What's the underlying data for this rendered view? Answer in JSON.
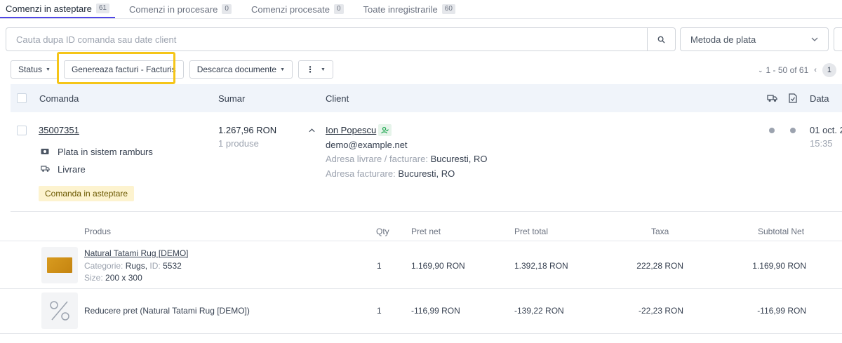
{
  "tabs": [
    {
      "label": "Comenzi in asteptare",
      "count": "61"
    },
    {
      "label": "Comenzi in procesare",
      "count": "0"
    },
    {
      "label": "Comenzi procesate",
      "count": "0"
    },
    {
      "label": "Toate inregistrarile",
      "count": "60"
    }
  ],
  "search": {
    "placeholder": "Cauta dupa ID comanda sau date client"
  },
  "filters": {
    "payment_method_placeholder": "Metoda de plata"
  },
  "toolbar": {
    "status_label": "Status",
    "generate_invoices_label": "Genereaza facturi - Facturis",
    "download_docs_label": "Descarca documente",
    "more_label": "⋮"
  },
  "pagination": {
    "range": "1 - 50 of 61",
    "page": "1"
  },
  "table_headers": {
    "order": "Comanda",
    "summary": "Sumar",
    "client": "Client",
    "date": "Data"
  },
  "order": {
    "id": "35007351",
    "payment": "Plata in sistem ramburs",
    "delivery": "Livrare",
    "status": "Comanda in asteptare",
    "total": "1.267,96 RON",
    "products_count": "1 produse",
    "client_name": "Ion Popescu",
    "client_email": "demo@example.net",
    "shipping_label": "Adresa livrare / facturare:",
    "shipping_value": "Bucuresti, RO",
    "billing_label": "Adresa facturare:",
    "billing_value": "Bucuresti, RO",
    "date": "01 oct. 2",
    "time": "15:35"
  },
  "products_headers": {
    "product": "Produs",
    "qty": "Qty",
    "net_price": "Pret net",
    "total_price": "Pret total",
    "tax": "Taxa",
    "subtotal": "Subtotal Net"
  },
  "products": [
    {
      "name": "Natural Tatami Rug [DEMO]",
      "category_label": "Categorie:",
      "category": "Rugs",
      "id_label": "ID:",
      "id": "5532",
      "size_label": "Size:",
      "size": "200 x 300",
      "qty": "1",
      "net_price": "1.169,90 RON",
      "total_price": "1.392,18 RON",
      "tax": "222,28 RON",
      "subtotal": "1.169,90 RON"
    },
    {
      "name": "Reducere pret (Natural Tatami Rug [DEMO])",
      "qty": "1",
      "net_price": "-116,99 RON",
      "total_price": "-139,22 RON",
      "tax": "-22,23 RON",
      "subtotal": "-116,99 RON"
    }
  ]
}
